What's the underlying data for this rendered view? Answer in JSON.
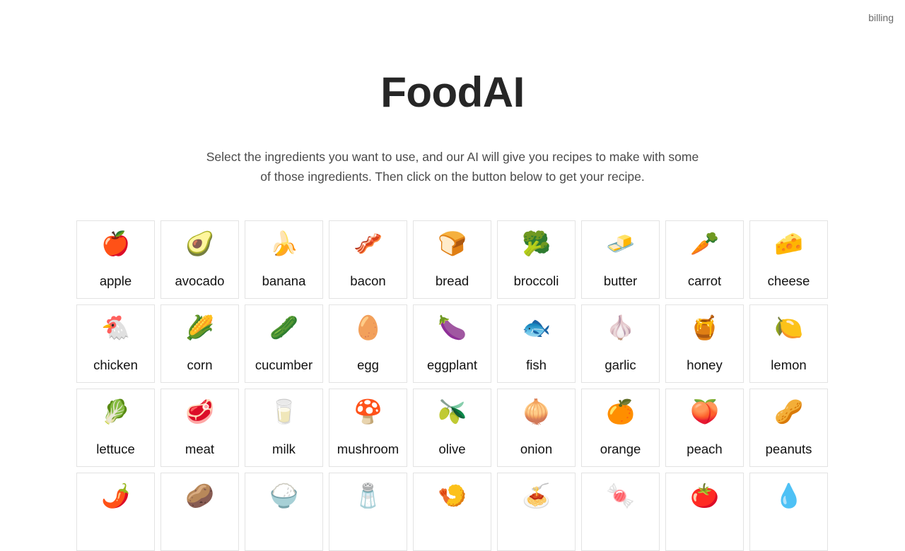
{
  "header": {
    "billing_link": "billing"
  },
  "page": {
    "title": "FoodAI",
    "description": "Select the ingredients you want to use, and our AI will give you recipes to make with some of those ingredients. Then click on the button below to get your recipe."
  },
  "ingredients": [
    {
      "name": "apple",
      "emoji": "🍎"
    },
    {
      "name": "avocado",
      "emoji": "🥑"
    },
    {
      "name": "banana",
      "emoji": "🍌"
    },
    {
      "name": "bacon",
      "emoji": "🥓"
    },
    {
      "name": "bread",
      "emoji": "🍞"
    },
    {
      "name": "broccoli",
      "emoji": "🥦"
    },
    {
      "name": "butter",
      "emoji": "🧈"
    },
    {
      "name": "carrot",
      "emoji": "🥕"
    },
    {
      "name": "cheese",
      "emoji": "🧀"
    },
    {
      "name": "chicken",
      "emoji": "🐔"
    },
    {
      "name": "corn",
      "emoji": "🌽"
    },
    {
      "name": "cucumber",
      "emoji": "🥒"
    },
    {
      "name": "egg",
      "emoji": "🥚"
    },
    {
      "name": "eggplant",
      "emoji": "🍆"
    },
    {
      "name": "fish",
      "emoji": "🐟"
    },
    {
      "name": "garlic",
      "emoji": "🧄"
    },
    {
      "name": "honey",
      "emoji": "🍯"
    },
    {
      "name": "lemon",
      "emoji": "🍋"
    },
    {
      "name": "lettuce",
      "emoji": "🥬"
    },
    {
      "name": "meat",
      "emoji": "🥩"
    },
    {
      "name": "milk",
      "emoji": "🥛"
    },
    {
      "name": "mushroom",
      "emoji": "🍄"
    },
    {
      "name": "olive",
      "emoji": "🫒"
    },
    {
      "name": "onion",
      "emoji": "🧅"
    },
    {
      "name": "orange",
      "emoji": "🍊"
    },
    {
      "name": "peach",
      "emoji": "🍑"
    },
    {
      "name": "peanuts",
      "emoji": "🥜"
    },
    {
      "name": "",
      "emoji": "🌶️"
    },
    {
      "name": "",
      "emoji": "🥔"
    },
    {
      "name": "",
      "emoji": "🍚"
    },
    {
      "name": "",
      "emoji": "🧂"
    },
    {
      "name": "",
      "emoji": "🍤"
    },
    {
      "name": "",
      "emoji": "🍝"
    },
    {
      "name": "",
      "emoji": "🍬"
    },
    {
      "name": "",
      "emoji": "🍅"
    },
    {
      "name": "",
      "emoji": "💧"
    }
  ]
}
